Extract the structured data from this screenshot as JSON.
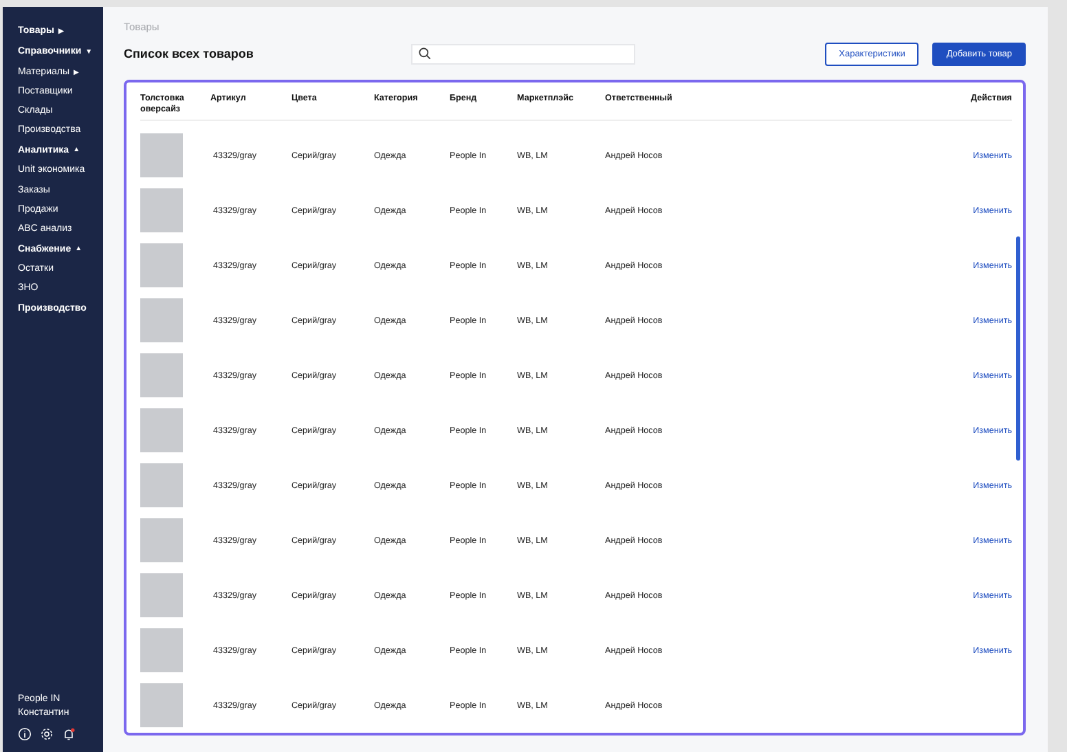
{
  "sidebar": {
    "items": [
      {
        "label": "Товары",
        "arrow": "▶",
        "kind": "section"
      },
      {
        "label": "Справочники",
        "arrow": "▼",
        "kind": "section"
      },
      {
        "label": "Материалы",
        "arrow": "▶",
        "kind": "item"
      },
      {
        "label": "Поставщики",
        "kind": "item"
      },
      {
        "label": "Склады",
        "kind": "item"
      },
      {
        "label": "Производства",
        "kind": "item"
      },
      {
        "label": "Аналитика",
        "arrow": "▲",
        "kind": "section"
      },
      {
        "label": "Unit экономика",
        "kind": "item"
      },
      {
        "label": "Заказы",
        "kind": "item"
      },
      {
        "label": "Продажи",
        "kind": "item"
      },
      {
        "label": "ABC анализ",
        "kind": "item"
      },
      {
        "label": "Снабжение",
        "arrow": "▲",
        "kind": "section"
      },
      {
        "label": "Остатки",
        "kind": "item"
      },
      {
        "label": "ЗНО",
        "kind": "item"
      },
      {
        "label": "Производство",
        "kind": "section"
      }
    ],
    "company": "People IN",
    "user": "Константин",
    "notifications": true
  },
  "breadcrumb": "Товары",
  "title": "Список всех товаров",
  "buttons": [
    {
      "label": "Характеристики",
      "kind": "outline"
    },
    {
      "label": "Добавить товар",
      "kind": "primary"
    }
  ],
  "table": {
    "columns": [
      "Толстовка оверсайз",
      "Артикул",
      "Цвета",
      "Категория",
      "Бренд",
      "Маркетплэйс",
      "Ответственный",
      "Действия"
    ],
    "rows": [
      {
        "article": "43329/gray",
        "colors": "Серий/gray",
        "category": "Одежда",
        "brand": "People In",
        "marketplace": "WB, LM",
        "owner": "Андрей Носов",
        "action": "Изменить"
      },
      {
        "article": "43329/gray",
        "colors": "Серий/gray",
        "category": "Одежда",
        "brand": "People In",
        "marketplace": "WB, LM",
        "owner": "Андрей Носов",
        "action": "Изменить"
      },
      {
        "article": "43329/gray",
        "colors": "Серий/gray",
        "category": "Одежда",
        "brand": "People In",
        "marketplace": "WB, LM",
        "owner": "Андрей Носов",
        "action": "Изменить"
      },
      {
        "article": "43329/gray",
        "colors": "Серий/gray",
        "category": "Одежда",
        "brand": "People In",
        "marketplace": "WB, LM",
        "owner": "Андрей Носов",
        "action": "Изменить"
      },
      {
        "article": "43329/gray",
        "colors": "Серий/gray",
        "category": "Одежда",
        "brand": "People In",
        "marketplace": "WB, LM",
        "owner": "Андрей Носов",
        "action": "Изменить"
      },
      {
        "article": "43329/gray",
        "colors": "Серий/gray",
        "category": "Одежда",
        "brand": "People In",
        "marketplace": "WB, LM",
        "owner": "Андрей Носов",
        "action": "Изменить"
      },
      {
        "article": "43329/gray",
        "colors": "Серий/gray",
        "category": "Одежда",
        "brand": "People In",
        "marketplace": "WB, LM",
        "owner": "Андрей Носов",
        "action": "Изменить"
      },
      {
        "article": "43329/gray",
        "colors": "Серий/gray",
        "category": "Одежда",
        "brand": "People In",
        "marketplace": "WB, LM",
        "owner": "Андрей Носов",
        "action": "Изменить"
      },
      {
        "article": "43329/gray",
        "colors": "Серий/gray",
        "category": "Одежда",
        "brand": "People In",
        "marketplace": "WB, LM",
        "owner": "Андрей Носов",
        "action": "Изменить"
      },
      {
        "article": "43329/gray",
        "colors": "Серий/gray",
        "category": "Одежда",
        "brand": "People In",
        "marketplace": "WB, LM",
        "owner": "Андрей Носов",
        "action": "Изменить"
      },
      {
        "article": "43329/gray",
        "colors": "Серий/gray",
        "category": "Одежда",
        "brand": "People In",
        "marketplace": "WB, LM",
        "owner": "Андрей Носов"
      }
    ]
  }
}
